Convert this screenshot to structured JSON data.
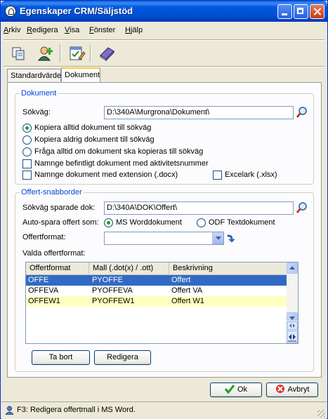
{
  "window": {
    "title": "Egenskaper CRM/Säljstöd"
  },
  "menu": [
    {
      "label": "Arkiv",
      "mnemonic": "A",
      "rest": "rkiv"
    },
    {
      "label": "Redigera",
      "mnemonic": "R",
      "rest": "edigera"
    },
    {
      "label": "Visa",
      "mnemonic": "V",
      "rest": "isa"
    },
    {
      "label": "Fönster",
      "mnemonic": "F",
      "rest": "önster"
    },
    {
      "label": "Hjälp",
      "mnemonic": "H",
      "rest": "jälp"
    }
  ],
  "toolbar": {
    "icons": [
      "copy-icon",
      "add-user-icon",
      "edit-checklist-icon",
      "book-icon"
    ]
  },
  "tabs": [
    {
      "label": "Standardvärde",
      "active": false
    },
    {
      "label": "Dokument",
      "active": true
    }
  ],
  "dokument": {
    "title": "Dokument",
    "path_label": "Sökväg:",
    "path_value": "D:\\340A\\Murgrona\\Dokument\\",
    "radio_always": "Kopiera alltid dokument till sökväg",
    "radio_never": "Kopiera aldrig dokument till sökväg",
    "radio_ask": "Fråga alltid om dokument ska kopieras till sökväg",
    "selected_radio": "always",
    "check_rename_activity": "Namnge befintligt dokument med aktivitetsnummer",
    "check_rename_extension": "Namnge dokument med extension (.docx)",
    "check_excel": "Excelark (.xlsx)"
  },
  "offert": {
    "title": "Offert-snabborder",
    "save_path_label": "Sökväg sparade dok:",
    "save_path_value": "D:\\340A\\DOK\\Offert\\",
    "autosave_label": "Auto-spara offert som:",
    "option_word": "MS Worddokument",
    "option_odf": "ODF Textdokument",
    "selected_option": "word",
    "format_label": "Offertformat:",
    "format_value": "",
    "selected_formats_label": "Valda offertformat:",
    "columns": [
      "Offertformat",
      "Mall (.dot(x) / .ott)",
      "Beskrivning"
    ],
    "rows": [
      {
        "format": "OFFE",
        "template": "PYOFFE",
        "description": "Offert",
        "state": "selected"
      },
      {
        "format": "OFFEVA",
        "template": "PYOFFEVA",
        "description": "Offert VA",
        "state": "normal"
      },
      {
        "format": "OFFEW1",
        "template": "PYOFFEW1",
        "description": "Offert W1",
        "state": "yellow"
      }
    ],
    "remove_button": "Ta bort",
    "edit_button": "Redigera"
  },
  "buttons": {
    "ok": "Ok",
    "cancel": "Avbryt"
  },
  "status": {
    "text": "F3: Redigera offertmall i MS Word."
  },
  "colors": {
    "accent": "#0046d5",
    "selection": "#316ac5",
    "highlight_row": "#ffffc0"
  }
}
